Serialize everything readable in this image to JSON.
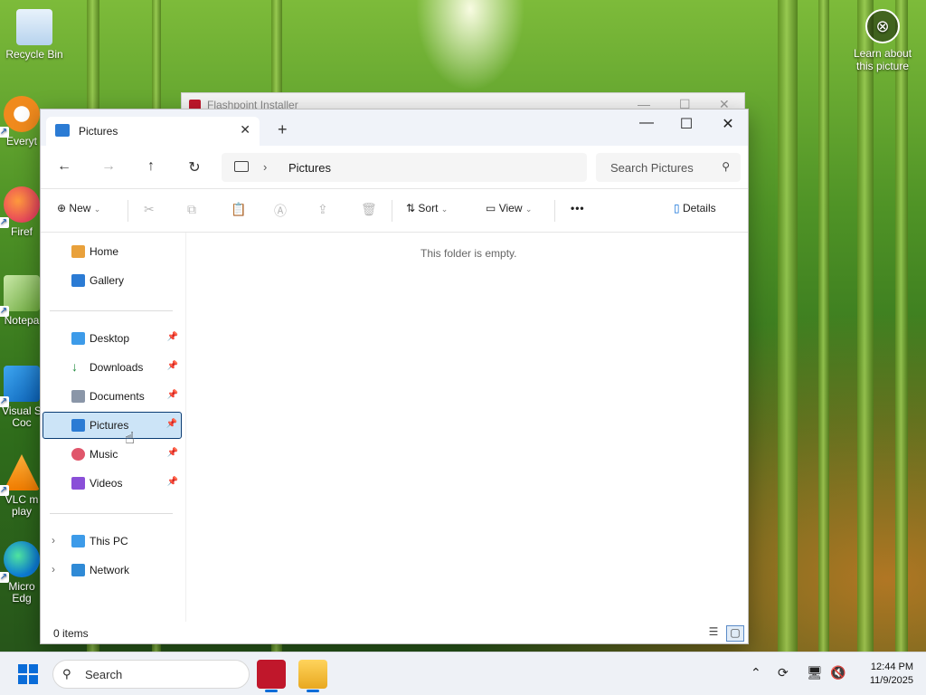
{
  "desktop": {
    "icons": [
      {
        "label": "Recycle Bin",
        "icon": "recycle-bin-icon"
      },
      {
        "label": "Everyt",
        "icon": "everything-icon"
      },
      {
        "label": "Firef",
        "icon": "firefox-icon"
      },
      {
        "label": "Notepa",
        "icon": "notepad-plus-plus-icon"
      },
      {
        "label": "Visual S",
        "label2": "Coc",
        "icon": "vscode-icon"
      },
      {
        "label": "VLC m",
        "label2": "play",
        "icon": "vlc-icon"
      },
      {
        "label": "Micro",
        "label2": "Edg",
        "icon": "edge-icon"
      }
    ],
    "spotlight": {
      "line1": "Learn about",
      "line2": "this picture"
    }
  },
  "back_window": {
    "title": "Flashpoint Installer"
  },
  "explorer": {
    "tab_title": "Pictures",
    "address": {
      "crumb": "Pictures"
    },
    "search": {
      "placeholder": "Search Pictures"
    },
    "commands": {
      "new": "New",
      "sort": "Sort",
      "view": "View",
      "more": "•••",
      "details": "Details"
    },
    "nav": {
      "home": "Home",
      "gallery": "Gallery",
      "desktop": "Desktop",
      "downloads": "Downloads",
      "documents": "Documents",
      "pictures": "Pictures",
      "music": "Music",
      "videos": "Videos",
      "this_pc": "This PC",
      "network": "Network"
    },
    "empty_message": "This folder is empty.",
    "status": "0 items"
  },
  "taskbar": {
    "search_placeholder": "Search",
    "time": "12:44 PM",
    "date": "11/9/2025"
  },
  "colors": {
    "accent": "#0a6cd8",
    "selection": "#cce4f7"
  }
}
